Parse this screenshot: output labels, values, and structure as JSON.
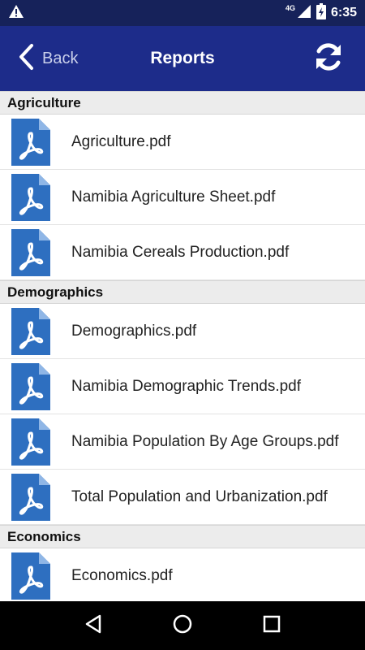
{
  "status_bar": {
    "time": "6:35",
    "network": "4G",
    "icons": [
      "warning-icon",
      "signal-icon",
      "battery-charging-icon"
    ]
  },
  "app_bar": {
    "back_label": "Back",
    "title": "Reports",
    "refresh_icon": "refresh-icon"
  },
  "sections": [
    {
      "title": "Agriculture",
      "items": [
        "Agriculture.pdf",
        "Namibia Agriculture Sheet.pdf",
        "Namibia Cereals Production.pdf"
      ]
    },
    {
      "title": "Demographics",
      "items": [
        "Demographics.pdf",
        "Namibia Demographic Trends.pdf",
        "Namibia Population By Age Groups.pdf",
        "Total Population and Urbanization.pdf"
      ]
    },
    {
      "title": "Economics",
      "items": [
        "Economics.pdf"
      ]
    }
  ],
  "nav_bar": {
    "icons": [
      "back-triangle-icon",
      "home-circle-icon",
      "recents-square-icon"
    ]
  },
  "colors": {
    "status_bar": "#16225a",
    "app_bar": "#1d2c8a",
    "pdf_icon": "#2e6fc0",
    "section_header": "#ececec"
  }
}
